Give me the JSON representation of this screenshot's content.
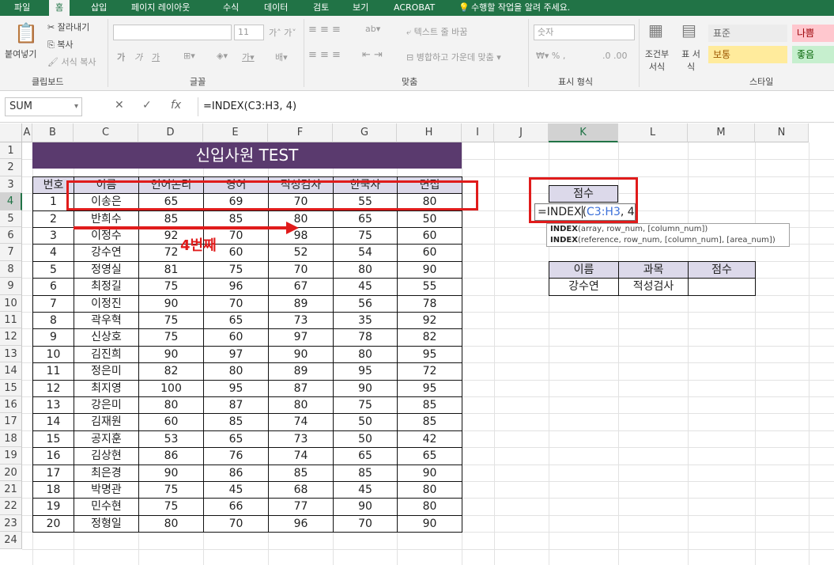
{
  "ribbon_tabs": [
    "파일",
    "홈",
    "삽입",
    "페이지 레이아웃",
    "수식",
    "데이터",
    "검토",
    "보기",
    "ACROBAT",
    "수행할 작업을 알려 주세요."
  ],
  "active_tab": "홈",
  "clipboard": {
    "paste": "붙여넣기",
    "cut": "잘라내기",
    "copy": "복사",
    "format_painter": "서식 복사",
    "label": "클립보드"
  },
  "font_group": {
    "font_size": "11",
    "label": "글꼴",
    "bold": "가",
    "italic": "가",
    "underline": "가"
  },
  "align_group": {
    "wrap": "텍스트 줄 바꿈",
    "merge": "병합하고 가운데 맞춤",
    "label": "맞춤"
  },
  "number_group": {
    "format": "숫자",
    "label": "표시 형식"
  },
  "styles_group": {
    "conditional": "조건부 서식",
    "table": "표 서식",
    "normal": "표준",
    "bad": "나쁨",
    "neutral": "보통",
    "good": "좋음",
    "label": "스타일"
  },
  "formula_bar": {
    "name_box": "SUM",
    "cancel": "✕",
    "enter": "✓",
    "fx": "fx",
    "formula": "=INDEX(C3:H3, 4)"
  },
  "columns": [
    "A",
    "B",
    "C",
    "D",
    "E",
    "F",
    "G",
    "H",
    "I",
    "J",
    "K",
    "L",
    "M",
    "N"
  ],
  "rows": [
    "1",
    "2",
    "3",
    "4",
    "5",
    "6",
    "7",
    "8",
    "9",
    "10",
    "11",
    "12",
    "13",
    "14",
    "15",
    "16",
    "17",
    "18",
    "19",
    "20",
    "21",
    "22",
    "23",
    "24"
  ],
  "sheet_title": "신입사원 TEST",
  "table_headers": [
    "번호",
    "이름",
    "언어논리",
    "영어",
    "적성검사",
    "한국사",
    "면접"
  ],
  "table_rows": [
    [
      "1",
      "이송은",
      "65",
      "69",
      "70",
      "55",
      "80"
    ],
    [
      "2",
      "반희수",
      "85",
      "85",
      "80",
      "65",
      "50"
    ],
    [
      "3",
      "이정수",
      "92",
      "70",
      "98",
      "75",
      "60"
    ],
    [
      "4",
      "강수연",
      "72",
      "60",
      "52",
      "54",
      "60"
    ],
    [
      "5",
      "정영실",
      "81",
      "75",
      "70",
      "80",
      "90"
    ],
    [
      "6",
      "최정길",
      "75",
      "96",
      "67",
      "45",
      "55"
    ],
    [
      "7",
      "이정진",
      "90",
      "70",
      "89",
      "56",
      "78"
    ],
    [
      "8",
      "곽우혁",
      "75",
      "65",
      "73",
      "35",
      "92"
    ],
    [
      "9",
      "신상호",
      "75",
      "60",
      "97",
      "78",
      "82"
    ],
    [
      "10",
      "김진희",
      "90",
      "97",
      "90",
      "80",
      "95"
    ],
    [
      "11",
      "정은미",
      "82",
      "80",
      "89",
      "95",
      "72"
    ],
    [
      "12",
      "최지영",
      "100",
      "95",
      "87",
      "90",
      "95"
    ],
    [
      "13",
      "강은미",
      "80",
      "87",
      "80",
      "75",
      "85"
    ],
    [
      "14",
      "김재원",
      "60",
      "85",
      "74",
      "50",
      "85"
    ],
    [
      "15",
      "공지훈",
      "53",
      "65",
      "73",
      "50",
      "42"
    ],
    [
      "16",
      "김상현",
      "86",
      "76",
      "74",
      "65",
      "65"
    ],
    [
      "17",
      "최은경",
      "90",
      "86",
      "85",
      "85",
      "90"
    ],
    [
      "18",
      "박명관",
      "75",
      "45",
      "68",
      "45",
      "80"
    ],
    [
      "19",
      "민수현",
      "75",
      "66",
      "77",
      "90",
      "80"
    ],
    [
      "20",
      "정형일",
      "80",
      "70",
      "96",
      "70",
      "90"
    ]
  ],
  "score_label": "점수",
  "edit_formula": {
    "prefix": "=INDEX",
    "paren": "(",
    "ref": "C3:H3",
    "rest": ", 4)"
  },
  "tooltip": {
    "line1_fn": "INDEX",
    "line1_args": "(array, row_num, [column_num])",
    "line2_fn": "INDEX",
    "line2_args": "(reference, row_num, [column_num], [area_num])"
  },
  "annotation": "4번째",
  "lookup_table": {
    "headers": [
      "이름",
      "과목",
      "점수"
    ],
    "values": [
      "강수연",
      "적성검사",
      ""
    ]
  },
  "colors": {
    "excel_green": "#217346",
    "title_purple": "#5a3a6e",
    "header_fill": "#dcd9ea",
    "annotation_red": "#e01b1b"
  }
}
